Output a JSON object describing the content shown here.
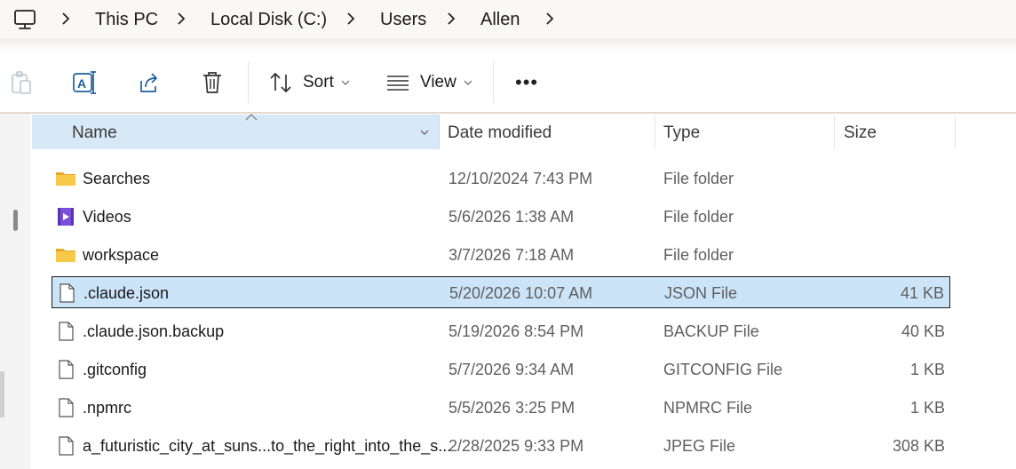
{
  "breadcrumb": {
    "items": [
      "This PC",
      "Local Disk (C:)",
      "Users",
      "Allen"
    ]
  },
  "toolbar": {
    "sort_label": "Sort",
    "view_label": "View",
    "more_label": "•••"
  },
  "columns": {
    "name": "Name",
    "date": "Date modified",
    "type": "Type",
    "size": "Size"
  },
  "files": [
    {
      "name": "Searches",
      "date": "12/10/2024 7:43 PM",
      "type": "File folder",
      "size": "",
      "icon": "folder-icon"
    },
    {
      "name": "Videos",
      "date": "5/6/2026 1:38 AM",
      "type": "File folder",
      "size": "",
      "icon": "videos-folder-icon"
    },
    {
      "name": "workspace",
      "date": "3/7/2026 7:18 AM",
      "type": "File folder",
      "size": "",
      "icon": "folder-icon"
    },
    {
      "name": ".claude.json",
      "date": "5/20/2026 10:07 AM",
      "type": "JSON File",
      "size": "41 KB",
      "icon": "file-icon",
      "selected": true
    },
    {
      "name": ".claude.json.backup",
      "date": "5/19/2026 8:54 PM",
      "type": "BACKUP File",
      "size": "40 KB",
      "icon": "file-icon"
    },
    {
      "name": ".gitconfig",
      "date": "5/7/2026 9:34 AM",
      "type": "GITCONFIG File",
      "size": "1 KB",
      "icon": "file-icon"
    },
    {
      "name": ".npmrc",
      "date": "5/5/2026 3:25 PM",
      "type": "NPMRC File",
      "size": "1 KB",
      "icon": "file-icon"
    },
    {
      "name": "a_futuristic_city_at_suns...to_the_right_into_the_s...",
      "date": "2/28/2025 9:33 PM",
      "type": "JPEG File",
      "size": "308 KB",
      "icon": "file-icon"
    }
  ],
  "colors": {
    "selection": "#cce4f7",
    "header_highlight": "#d7e8f6",
    "folder": "#f8c948"
  }
}
